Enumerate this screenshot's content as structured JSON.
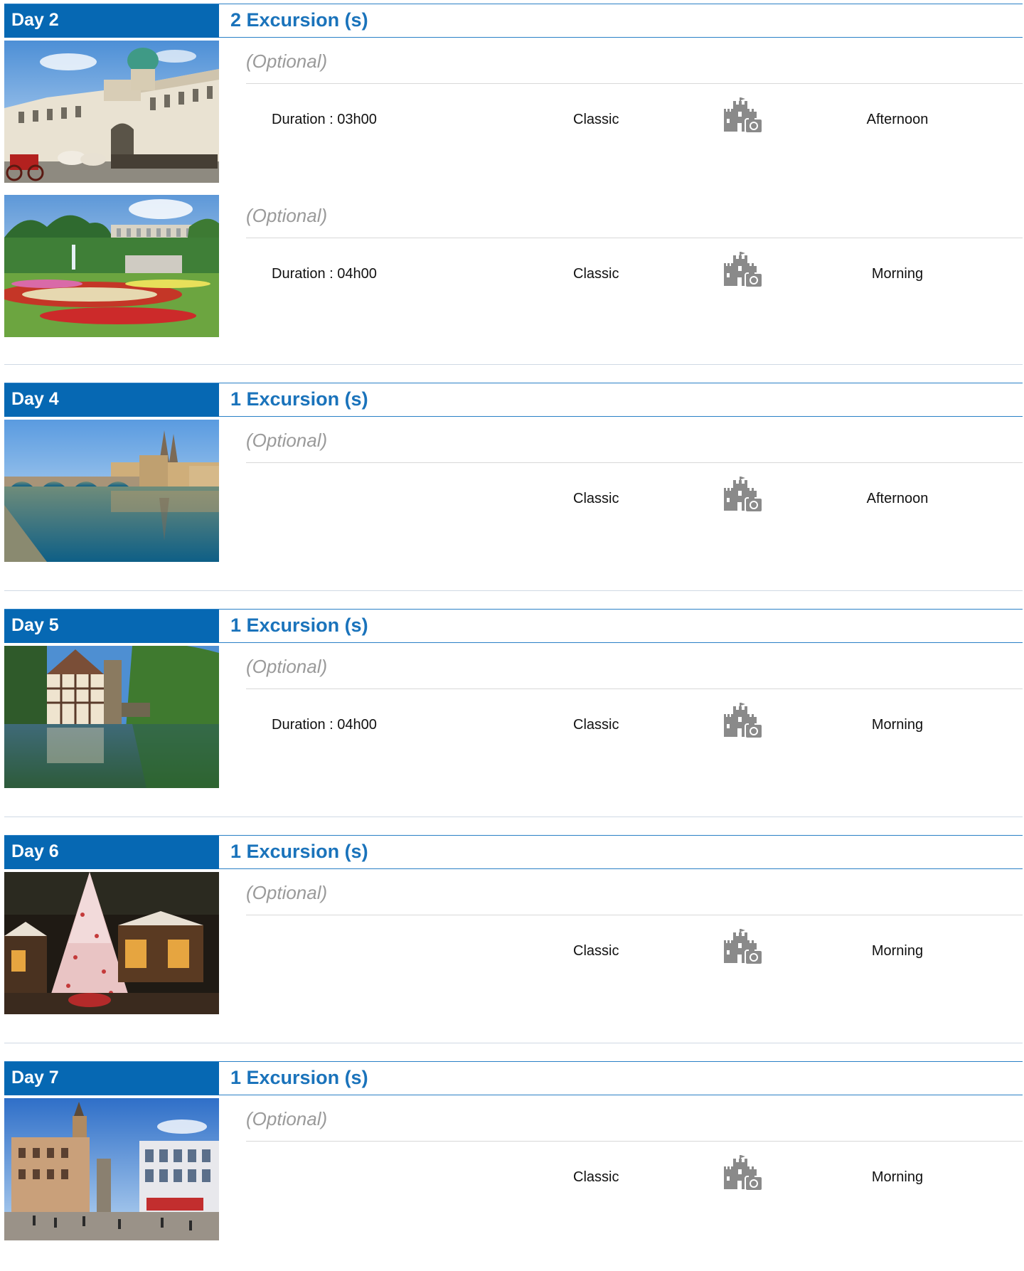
{
  "days": [
    {
      "label": "Day 2",
      "count_label": "2 Excursion (s)",
      "excursions": [
        {
          "optional_label": "(Optional)",
          "duration": "Duration : 03h00",
          "category": "Classic",
          "icon": "castle-camera-icon",
          "time_of_day": "Afternoon",
          "photo": "palace-carriages"
        },
        {
          "optional_label": "(Optional)",
          "duration": "Duration : 04h00",
          "category": "Classic",
          "icon": "castle-camera-icon",
          "time_of_day": "Morning",
          "photo": "palace-gardens"
        }
      ]
    },
    {
      "label": "Day 4",
      "count_label": "1 Excursion (s)",
      "excursions": [
        {
          "optional_label": "(Optional)",
          "duration": "",
          "category": "Classic",
          "icon": "castle-camera-icon",
          "time_of_day": "Afternoon",
          "photo": "stone-bridge-river"
        }
      ]
    },
    {
      "label": "Day 5",
      "count_label": "1 Excursion (s)",
      "excursions": [
        {
          "optional_label": "(Optional)",
          "duration": "Duration : 04h00",
          "category": "Classic",
          "icon": "castle-camera-icon",
          "time_of_day": "Morning",
          "photo": "timber-house-river"
        }
      ]
    },
    {
      "label": "Day 6",
      "count_label": "1 Excursion (s)",
      "excursions": [
        {
          "optional_label": "(Optional)",
          "duration": "",
          "category": "Classic",
          "icon": "castle-camera-icon",
          "time_of_day": "Morning",
          "photo": "christmas-tree-village"
        }
      ]
    },
    {
      "label": "Day 7",
      "count_label": "1 Excursion (s)",
      "excursions": [
        {
          "optional_label": "(Optional)",
          "duration": "",
          "category": "Classic",
          "icon": "castle-camera-icon",
          "time_of_day": "Morning",
          "photo": "town-square"
        }
      ]
    }
  ],
  "colors": {
    "header_bg": "#0668b3",
    "header_text": "#ffffff",
    "count_text": "#1a73bb",
    "optional_text": "#9a9a9a",
    "icon_gray": "#8a8a8a"
  }
}
